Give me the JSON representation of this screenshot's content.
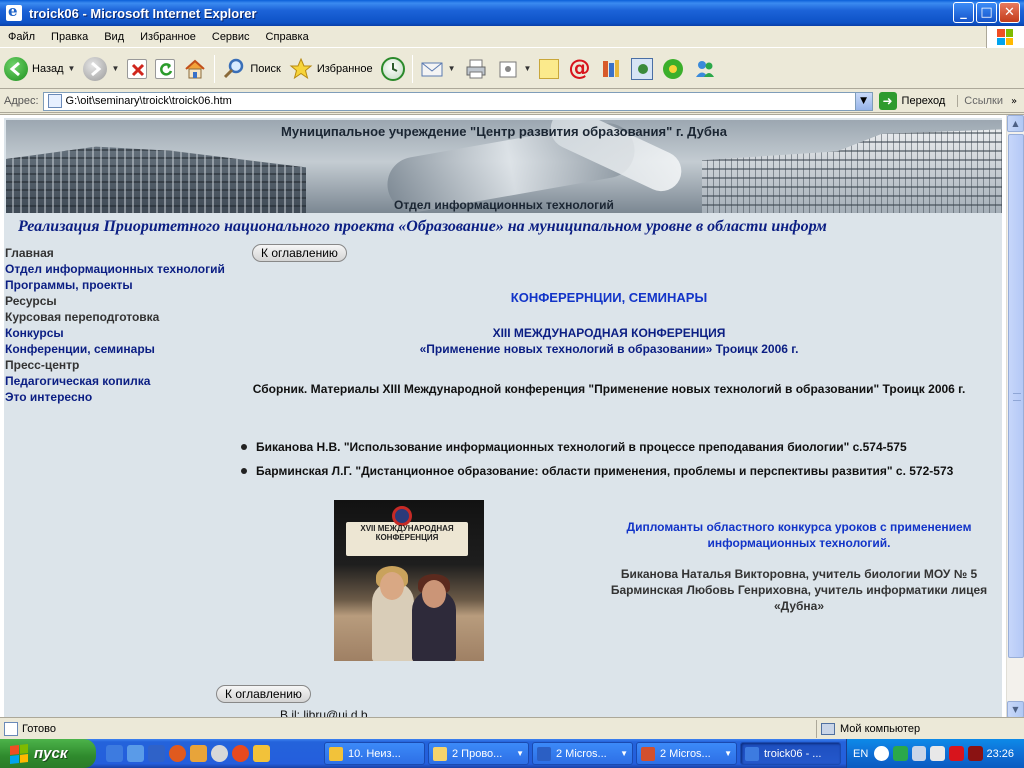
{
  "window": {
    "title": "troick06 - Microsoft Internet Explorer",
    "controls": [
      "_",
      "□",
      "✕"
    ]
  },
  "menu": [
    "Файл",
    "Правка",
    "Вид",
    "Избранное",
    "Сервис",
    "Справка"
  ],
  "toolbar": {
    "back": "Назад",
    "search": "Поиск",
    "favorites": "Избранное"
  },
  "address": {
    "label": "Адрес:",
    "url": "G:\\oit\\seminary\\troick\\troick06.htm",
    "go": "Переход",
    "links": "Ссылки",
    "links_chevron": "»"
  },
  "banner": {
    "top": "Муниципальное учреждение \"Центр развития образования\" г. Дубна",
    "bottom": "Отдел информационных технологий"
  },
  "slogan": "Реализация Приоритетного национального проекта «Образование» на муниципальном уровне в области информ",
  "nav": [
    {
      "label": "Главная",
      "style": "gray"
    },
    {
      "label": "Отдел информационных технологий",
      "style": "link"
    },
    {
      "label": "Программы, проекты",
      "style": "link"
    },
    {
      "label": "Ресурсы",
      "style": "gray"
    },
    {
      "label": "Курсовая переподготовка",
      "style": "gray"
    },
    {
      "label": "Конкурсы",
      "style": "link"
    },
    {
      "label": "Конференции, семинары",
      "style": "link"
    },
    {
      "label": "Пресс-центр",
      "style": "gray"
    },
    {
      "label": "Педагогическая копилка",
      "style": "link"
    },
    {
      "label": "Это интересно",
      "style": "link"
    }
  ],
  "content": {
    "toc_button": "К оглавлению",
    "section_title": "КОНФЕРЕРНЦИИ, СЕМИНАРЫ",
    "conference_line1": "XIII МЕЖДУНАРОДНАЯ КОНФЕРЕНЦИЯ",
    "conference_line2": "«Применение новых технологий в образовании» Троицк 2006 г.",
    "sbornik": "Сборник. Материалы XIII Международной конференция \"Применение новых технологий в образовании\" Троицк 2006 г.",
    "items": [
      "Биканова Н.В. \"Использование информационных технологий в процессе преподавания биологии\" с.574-575",
      "Барминская Л.Г. \"Дистанционное образование: области применения, проблемы и перспективы развития\" с. 572-573"
    ],
    "photo_sign": "XVII МЕЖДУНАРОДНАЯ КОНФЕРЕНЦИЯ",
    "diploma_title": "Дипломанты областного конкурса уроков с применением информационных технологий.",
    "person1": "Биканова Наталья Викторовна, учитель биологии МОУ № 5",
    "person2": "Барминская Любовь Генриховна, учитель информатики лицея «Дубна»",
    "cut_text": "В                                              il: libru@ui d b"
  },
  "status": {
    "text": "Готово",
    "zone": "Мой компьютер"
  },
  "taskbar": {
    "start": "пуск",
    "tasks": [
      {
        "label": "10. Неиз...",
        "icon_color": "#F2C23A"
      },
      {
        "label": "2 Прово...",
        "icon_color": "#F5D36B"
      },
      {
        "label": "2 Micros...",
        "icon_color": "#2B5FC4"
      },
      {
        "label": "2 Micros...",
        "icon_color": "#D2502E"
      },
      {
        "label": "troick06 - ...",
        "icon_color": "#3D7BE0"
      }
    ],
    "lang": "EN",
    "clock": "23:26"
  }
}
